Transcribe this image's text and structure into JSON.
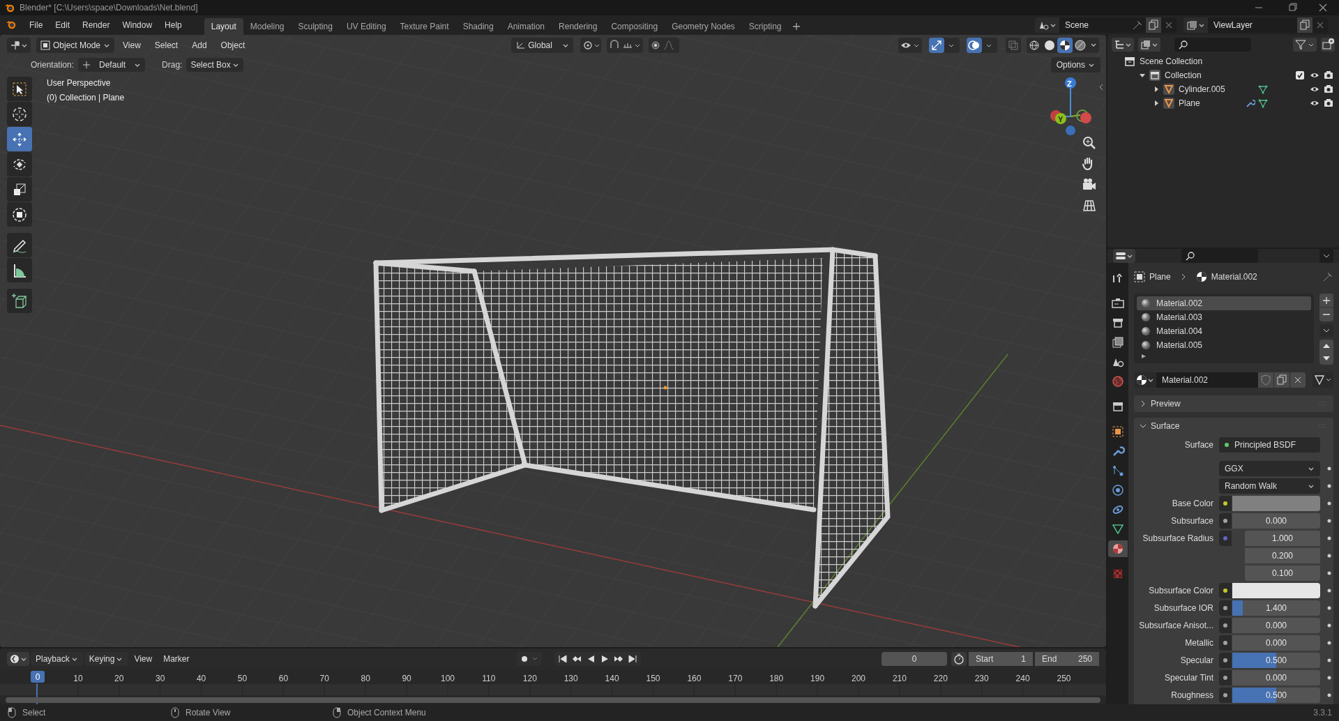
{
  "window": {
    "title": "Blender* [C:\\Users\\space\\Downloads\\Net.blend]"
  },
  "menu": [
    "File",
    "Edit",
    "Render",
    "Window",
    "Help"
  ],
  "workspaces": [
    {
      "label": "Layout",
      "selected": true
    },
    {
      "label": "Modeling",
      "selected": false
    },
    {
      "label": "Sculpting",
      "selected": false
    },
    {
      "label": "UV Editing",
      "selected": false
    },
    {
      "label": "Texture Paint",
      "selected": false
    },
    {
      "label": "Shading",
      "selected": false
    },
    {
      "label": "Animation",
      "selected": false
    },
    {
      "label": "Rendering",
      "selected": false
    },
    {
      "label": "Compositing",
      "selected": false
    },
    {
      "label": "Geometry Nodes",
      "selected": false
    },
    {
      "label": "Scripting",
      "selected": false
    }
  ],
  "scene": {
    "name": "Scene"
  },
  "view_layer": {
    "name": "ViewLayer"
  },
  "viewport_header": {
    "mode": "Object Mode",
    "menus": [
      "View",
      "Select",
      "Add",
      "Object"
    ],
    "transform": "Global",
    "shading": [
      {
        "kind": "wireframe",
        "selected": false
      },
      {
        "kind": "solid",
        "selected": false
      },
      {
        "kind": "material",
        "selected": true
      },
      {
        "kind": "rendered",
        "selected": false
      }
    ]
  },
  "tool_settings": {
    "orientation_label": "Orientation:",
    "orientation": "Default",
    "drag_label": "Drag:",
    "drag": "Select Box",
    "options": "Options"
  },
  "toolbar": [
    {
      "kind": "select_box",
      "selected": false
    },
    {
      "kind": "cursor",
      "selected": false
    },
    {
      "kind": "move",
      "selected": true
    },
    {
      "kind": "rotate",
      "selected": false
    },
    {
      "kind": "scale",
      "selected": false
    },
    {
      "kind": "transform",
      "selected": false
    },
    {
      "kind": "annotate",
      "selected": false
    },
    {
      "kind": "measure",
      "selected": false
    },
    {
      "kind": "add_cube",
      "selected": false
    }
  ],
  "viewport_info": [
    "User Perspective",
    "(0) Collection | Plane"
  ],
  "gizmo": {
    "z_label": "Z",
    "y_label": "Y"
  },
  "outliner": {
    "tree": [
      {
        "label": "Scene Collection",
        "kind": "scene_collection",
        "children": [
          {
            "label": "Collection",
            "kind": "collection",
            "expanded": true,
            "checked": true,
            "children": [
              {
                "label": "Cylinder.005",
                "kind": "mesh",
                "expanded": false,
                "has_modifier": false
              },
              {
                "label": "Plane",
                "kind": "mesh",
                "expanded": false,
                "has_modifier": true
              }
            ]
          }
        ]
      }
    ]
  },
  "properties": {
    "tabs": [
      {
        "kind": "tool",
        "selected": false
      },
      {
        "kind": "render",
        "selected": false
      },
      {
        "kind": "output",
        "selected": false
      },
      {
        "kind": "view_layer",
        "selected": false
      },
      {
        "kind": "scene",
        "selected": false
      },
      {
        "kind": "world",
        "selected": false
      },
      {
        "kind": "collection",
        "selected": false
      },
      {
        "kind": "object",
        "selected": false
      },
      {
        "kind": "modifier",
        "selected": false
      },
      {
        "kind": "particles",
        "selected": false
      },
      {
        "kind": "physics",
        "selected": false
      },
      {
        "kind": "constraints",
        "selected": false
      },
      {
        "kind": "data",
        "selected": false
      },
      {
        "kind": "material",
        "selected": true
      },
      {
        "kind": "texture",
        "selected": false
      }
    ],
    "breadcrumb": [
      "Plane",
      "Material.002"
    ],
    "material_slots": [
      {
        "label": "Material.002",
        "selected": true
      },
      {
        "label": "Material.003",
        "selected": false
      },
      {
        "label": "Material.004",
        "selected": false
      },
      {
        "label": "Material.005",
        "selected": false
      }
    ],
    "material_name": "Material.002",
    "panels": [
      {
        "label": "Preview",
        "expanded": false
      },
      {
        "label": "Surface",
        "expanded": true
      }
    ],
    "surface": {
      "label": "Surface",
      "value": "Principled BSDF"
    },
    "rows": [
      {
        "kind": "dropdown",
        "value": "GGX"
      },
      {
        "kind": "dropdown",
        "value": "Random Walk"
      },
      {
        "kind": "color",
        "label": "Base Color",
        "color": "#808080"
      },
      {
        "kind": "value",
        "label": "Subsurface",
        "value": "0.000",
        "level": 0
      },
      {
        "kind": "vector",
        "label": "Subsurface Radius",
        "values": [
          "1.000",
          "0.200",
          "0.100"
        ]
      },
      {
        "kind": "color",
        "label": "Subsurface Color",
        "color": "#e6e6e6"
      },
      {
        "kind": "value",
        "label": "Subsurface IOR",
        "value": "1.400",
        "level": 0.12
      },
      {
        "kind": "value",
        "label": "Subsurface Anisot...",
        "value": "0.000",
        "level": 0
      },
      {
        "kind": "value",
        "label": "Metallic",
        "value": "0.000",
        "level": 0
      },
      {
        "kind": "value",
        "label": "Specular",
        "value": "0.500",
        "level": 0.5
      },
      {
        "kind": "value",
        "label": "Specular Tint",
        "value": "0.000",
        "level": 0
      },
      {
        "kind": "value",
        "label": "Roughness",
        "value": "0.500",
        "level": 0.5
      }
    ]
  },
  "timeline": {
    "menus": [
      "Playback",
      "Keying",
      "View",
      "Marker"
    ],
    "current_frame": "0",
    "start_label": "Start",
    "start": "1",
    "end_label": "End",
    "end": "250",
    "playhead": "0",
    "ticks": [
      "10",
      "20",
      "30",
      "40",
      "50",
      "60",
      "70",
      "80",
      "90",
      "100",
      "110",
      "120",
      "130",
      "140",
      "150",
      "160",
      "170",
      "180",
      "190",
      "200",
      "210",
      "220",
      "230",
      "240",
      "250"
    ]
  },
  "status_bar": {
    "hints": [
      "Select",
      "Rotate View",
      "Object Context Menu"
    ],
    "version": "3.3.1"
  }
}
